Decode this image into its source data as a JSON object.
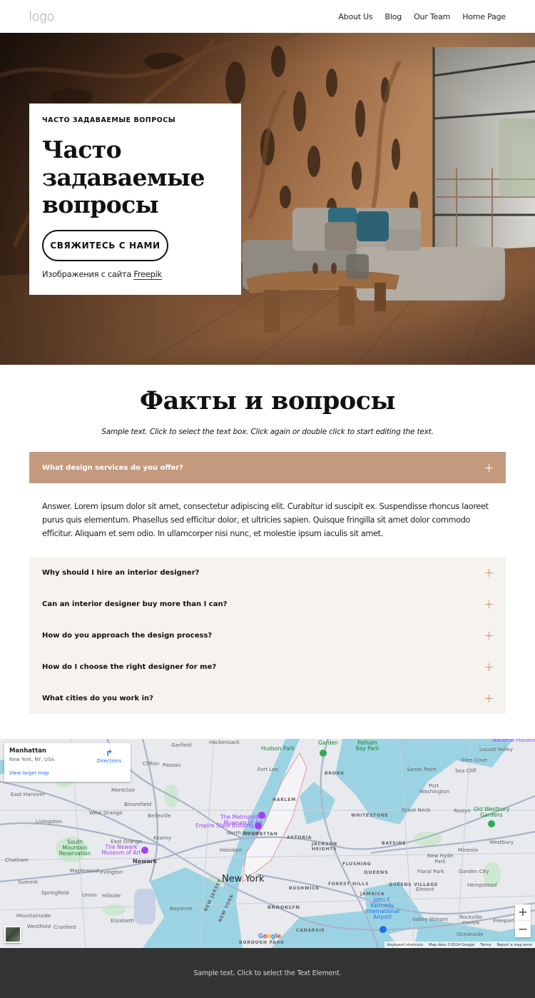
{
  "header": {
    "logo": "logo",
    "nav": [
      "About Us",
      "Blog",
      "Our Team",
      "Home Page"
    ]
  },
  "hero": {
    "eyebrow": "ЧАСТО ЗАДАВАЕМЫЕ ВОПРОСЫ",
    "title_lines": [
      "Часто",
      "задаваемые",
      "вопросы"
    ],
    "cta_label": "СВЯЖИТЕСЬ С НАМИ",
    "credit_prefix": "Изображения с сайта",
    "credit_link": "Freepik"
  },
  "faq": {
    "title": "Факты и вопросы",
    "subtitle": "Sample text. Click to select the text box. Click again or double click to start editing the text.",
    "active_question": "What design services do you offer?",
    "active_answer": "Answer. Lorem ipsum dolor sit amet, consectetur adipiscing elit. Curabitur id suscipit ex. Suspendisse rhoncus laoreet purus quis elementum. Phasellus sed efficitur dolor, et ultricies sapien. Quisque fringilla sit amet dolor commodo efficitur. Aliquam et sem odio. In ullamcorper nisi nunc, et molestie ipsum iaculis sit amet.",
    "questions": [
      "Why should I hire an interior designer?",
      "Can an interior designer buy more than I can?",
      "How do you approach the design process?",
      "How do I choose the right designer for me?",
      "What cities do you work in?"
    ],
    "accent_color": "#c49a7e",
    "list_bg": "#f6f2ee"
  },
  "map": {
    "place_name": "Manhattan",
    "place_address": "New York, NY, USA",
    "directions_label": "Directions",
    "larger_map_label": "View larger map",
    "zoom_in": "+",
    "zoom_out": "−",
    "attribution": [
      "Keyboard shortcuts",
      "Map data ©2024 Google",
      "Terms",
      "Report a map error"
    ],
    "labels": {
      "new_york": "New York",
      "manhattan": "MANHATTAN",
      "brooklyn": "BROOKLYN",
      "queens": "QUEENS",
      "bronx": "BRONX",
      "harlem": "HARLEM",
      "astoria": "ASTORIA",
      "jackson_heights": "JACKSON HEIGHTS",
      "flushing": "FLUSHING",
      "bayside": "BAYSIDE",
      "whitestone": "WHITESTONE",
      "forest_hills": "FOREST HILLS",
      "bushwick": "BUSHWICK",
      "jamaica": "JAMAICA",
      "queens_village": "QUEENS VILLAGE",
      "canarsie": "CANARSIE",
      "borough_park": "BOROUGH PARK",
      "newark": "Newark",
      "hoboken": "Hoboken",
      "fort_lee": "Fort Lee",
      "hackensack": "Hackensack",
      "garfield": "Garfield",
      "clifton": "Clifton",
      "passaic": "Passaic",
      "montclair": "Montclair",
      "bloomfield": "Bloomfield",
      "belleville": "Belleville",
      "north_bergen": "North Bergen",
      "east_hanover": "East Hanover",
      "livingston": "Livingston",
      "west_orange": "West Orange",
      "east_orange": "East Orange",
      "kearny": "Kearny",
      "chatham": "Chatham",
      "maplewood": "Maplewood",
      "irvington": "Irvington",
      "summit": "Summit",
      "springfield": "Springfield",
      "union": "Union",
      "hillside": "Hillside",
      "mountainside": "Mountainside",
      "westfield": "Westfield",
      "cranford": "Cranford",
      "elizabeth": "Elizabeth",
      "bayonne": "Bayonne",
      "new_jersey": "NEW JERSEY",
      "new_york_state": "NEW YORK",
      "locust_valley": "Locust Valley",
      "glen_cove": "Glen Cove",
      "sea_cliff": "Sea Cliff",
      "sands_point": "Sands Point",
      "port_washington": "Port Washington",
      "great_neck": "Great Neck",
      "roslyn": "Roslyn",
      "mineola": "Mineola",
      "westbury": "Westbury",
      "new_hyde_park": "New Hyde Park",
      "floral_park": "Floral Park",
      "garden_city": "Garden City",
      "hempstead": "Hempstead",
      "elmont": "Elmont",
      "valley_stream": "Valley Stream",
      "rockville_centre": "Rockville Centre",
      "freeport": "Freeport",
      "oceanside": "Oceanside",
      "jfk": "John F. Kennedy International Airport",
      "met_museum": "The Metropolitan Museum of Art",
      "empire_state": "Empire State Building",
      "newark_museum": "The Newark Museum of Art",
      "south_mountain": "South Mountain Reservation",
      "pelham_bay": "Pelham Bay Park",
      "hudson_park": "Hudson Park",
      "old_westbury": "Old Westbury Gardens",
      "botanical_garden": "Botanical Garden",
      "national_historic": "National Historic"
    }
  },
  "footer": {
    "text": "Sample text. Click to select the Text Element."
  }
}
